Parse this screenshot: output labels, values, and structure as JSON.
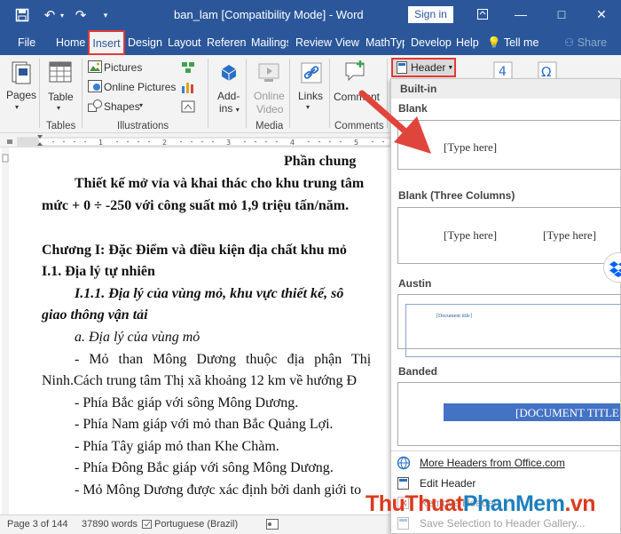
{
  "window": {
    "title": "ban_lam [Compatibility Mode]  -  Word",
    "sign_in": "Sign in",
    "minimize": "—",
    "restore": "□",
    "close": "✕"
  },
  "tabs": [
    {
      "label": "File"
    },
    {
      "label": "Home"
    },
    {
      "label": "Insert"
    },
    {
      "label": "Design"
    },
    {
      "label": "Layout"
    },
    {
      "label": "Referenc"
    },
    {
      "label": "Mailings"
    },
    {
      "label": "Review"
    },
    {
      "label": "View"
    },
    {
      "label": "MathTyp"
    },
    {
      "label": "Develop"
    },
    {
      "label": "Help"
    },
    {
      "label": "Tell me"
    },
    {
      "label": "Share"
    }
  ],
  "ribbon": {
    "pages": "Pages",
    "table": "Table",
    "pictures": "Pictures",
    "online_pictures": "Online Pictures",
    "shapes": "Shapes",
    "addins_1": "Add-",
    "addins_2": "ins",
    "online_video_1": "Online",
    "online_video_2": "Video",
    "links": "Links",
    "comment": "Comment",
    "header": "Header",
    "group_tables": "Tables",
    "group_illustrations": "Illustrations",
    "group_media": "Media",
    "group_comments": "Comments"
  },
  "document": {
    "lines": [
      "Phần chung",
      "Thiết kế mở vỉa và khai thác cho khu trung tâm",
      "mức + 0 ÷ -250 với công suất mỏ 1,9 triệu tấn/năm.",
      "Chương I: Đặc Điểm và điều kiện địa chất khu mỏ",
      "I.1. Địa lý tự  nhiên",
      "I.1.1. Địa lý của vùng mỏ, khu vực thiết kế, sô",
      "giao thông vận tải",
      "a. Địa lý của vùng mỏ",
      "- Mỏ than Mông Dương thuộc địa phận Thị",
      "Ninh.Cách trung tâm Thị xã khoảng 12 km về hướng Đ",
      "- Phía Bắc giáp với sông Mông Dương.",
      "- Phía Nam giáp với mỏ than Bắc Quảng Lợi.",
      "- Phía Tây giáp mỏ than Khe Chàm.",
      "- Phía Đông Bắc giáp với sông Mông Dương.",
      "- Mỏ Mông Dương được xác định bởi danh giới to"
    ]
  },
  "status": {
    "page": "Page 3 of 144",
    "words": "37890 words",
    "language": "Portuguese (Brazil)"
  },
  "gallery": {
    "builtin": "Built-in",
    "items": [
      {
        "name": "Blank",
        "placeholders": [
          "[Type here]"
        ]
      },
      {
        "name": "Blank (Three Columns)",
        "placeholders": [
          "[Type here]",
          "[Type here]"
        ]
      },
      {
        "name": "Austin",
        "placeholders": [
          "[Document title]"
        ]
      },
      {
        "name": "Banded",
        "placeholders": [
          "[DOCUMENT TITLE"
        ]
      }
    ],
    "menu": [
      {
        "label": "More Headers from Office.com",
        "enabled": true
      },
      {
        "label": "Edit Header",
        "enabled": true
      },
      {
        "label": "Remove Header",
        "enabled": false
      },
      {
        "label": "Save Selection to Header Gallery...",
        "enabled": false
      }
    ]
  },
  "watermark": {
    "part1": "ThuThuat",
    "part2": "PhanMem",
    "part3": ".vn"
  },
  "colors": {
    "word_blue": "#2b579a",
    "highlight_red": "#e03a35",
    "arrow_red": "#e0453b"
  }
}
